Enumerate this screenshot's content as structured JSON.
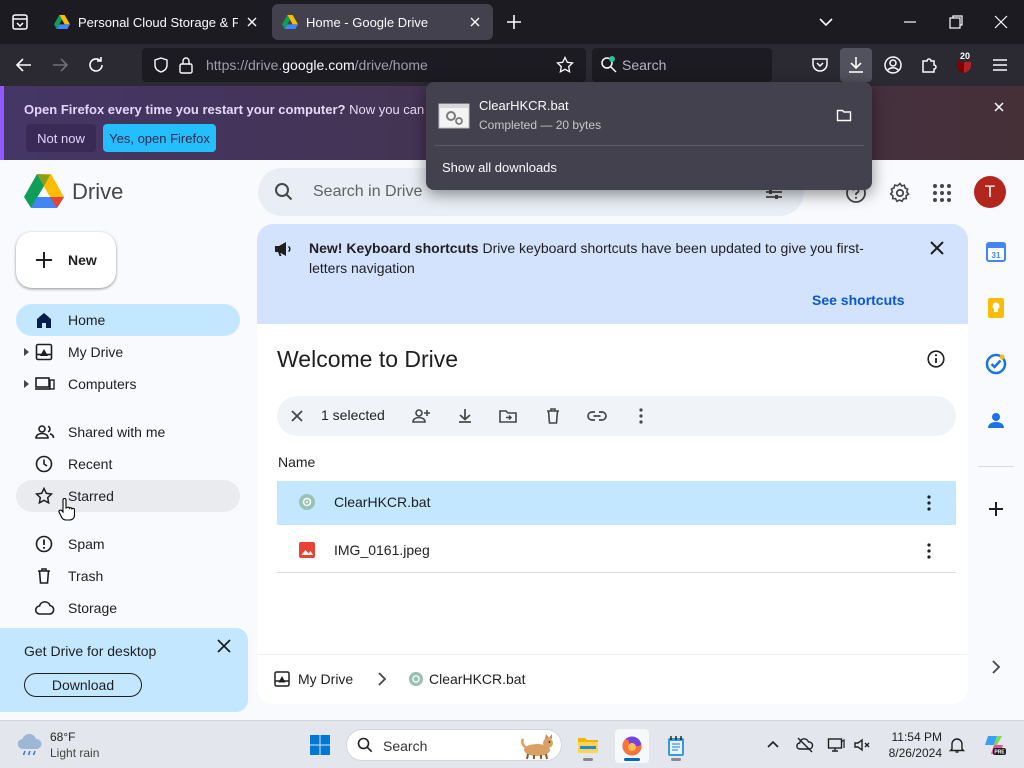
{
  "browser": {
    "tabs": [
      {
        "title": "Personal Cloud Storage & File S",
        "active": false
      },
      {
        "title": "Home - Google Drive",
        "active": true
      }
    ],
    "url_prefix": "https://drive.",
    "url_domain": "google.com",
    "url_path": "/drive/home",
    "search_placeholder": "Search",
    "extension_badge": "20"
  },
  "notification": {
    "bold_text": "Open Firefox every time you restart your computer?",
    "text": " Now you can set Fire",
    "not_now_label": "Not now",
    "yes_label": "Yes, open Firefox"
  },
  "downloads_panel": {
    "file_name": "ClearHKCR.bat",
    "status": "Completed — 20 bytes",
    "show_all_label": "Show all downloads"
  },
  "drive": {
    "app_name": "Drive",
    "search_placeholder": "Search in Drive",
    "avatar_letter": "T",
    "new_button_label": "New",
    "nav": [
      {
        "label": "Home",
        "icon": "home-icon",
        "active": true
      },
      {
        "label": "My Drive",
        "icon": "my-drive-icon"
      },
      {
        "label": "Computers",
        "icon": "computers-icon"
      },
      {
        "label": "Shared with me",
        "icon": "shared-icon"
      },
      {
        "label": "Recent",
        "icon": "clock-icon"
      },
      {
        "label": "Starred",
        "icon": "star-icon",
        "hover": true
      },
      {
        "label": "Spam",
        "icon": "spam-icon"
      },
      {
        "label": "Trash",
        "icon": "trash-icon"
      },
      {
        "label": "Storage",
        "icon": "cloud-icon"
      }
    ],
    "promo": {
      "title": "Get Drive for desktop",
      "button_label": "Download"
    },
    "banner": {
      "bold": "New! Keyboard shortcuts",
      "text": " Drive keyboard shortcuts have been updated to give you first-letters navigation",
      "link": "See shortcuts"
    },
    "welcome_title": "Welcome to Drive",
    "selection": {
      "count_text": "1 selected"
    },
    "column_name": "Name",
    "files": [
      {
        "name": "ClearHKCR.bat",
        "type": "bat",
        "selected": true
      },
      {
        "name": "IMG_0161.jpeg",
        "type": "image",
        "selected": false
      }
    ],
    "breadcrumb": {
      "root": "My Drive",
      "item": "ClearHKCR.bat"
    }
  },
  "taskbar": {
    "temperature": "68°F",
    "condition": "Light rain",
    "search_placeholder": "Search",
    "time": "11:54 PM",
    "date": "8/26/2024"
  },
  "colors": {
    "selected_row": "#c2e7ff",
    "banner_bg": "#d3e3fd",
    "link_blue": "#0b57d0",
    "firefox_accent": "#00ddff"
  }
}
